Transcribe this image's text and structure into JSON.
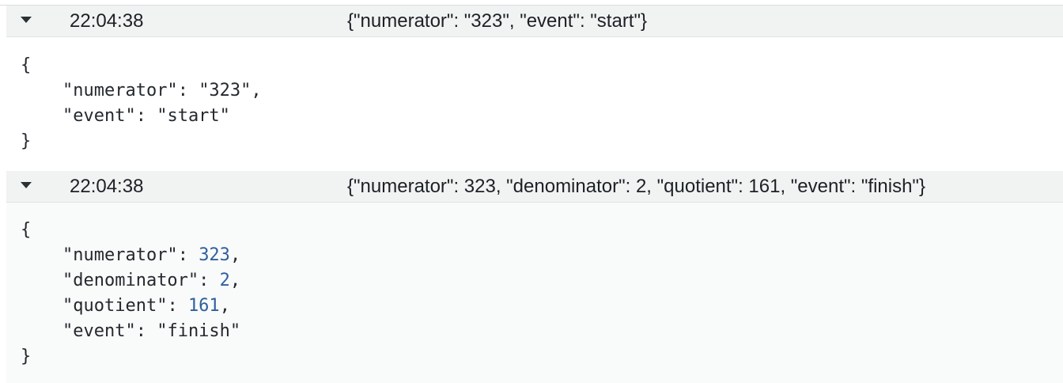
{
  "entries": [
    {
      "timestamp": "22:04:38",
      "message": "{\"numerator\": \"323\", \"event\": \"start\"}",
      "json": {
        "open": "{",
        "close": "}",
        "lines": [
          {
            "key": "\"numerator\"",
            "sep": ": ",
            "value": "\"323\"",
            "comma": ","
          },
          {
            "key": "\"event\"",
            "sep": ": ",
            "value": "\"start\"",
            "comma": ""
          }
        ]
      }
    },
    {
      "timestamp": "22:04:38",
      "message": "{\"numerator\": 323, \"denominator\": 2, \"quotient\": 161, \"event\": \"finish\"}",
      "json": {
        "open": "{",
        "close": "}",
        "lines": [
          {
            "key": "\"numerator\"",
            "sep": ": ",
            "value": "323",
            "comma": ","
          },
          {
            "key": "\"denominator\"",
            "sep": ": ",
            "value": "2",
            "comma": ","
          },
          {
            "key": "\"quotient\"",
            "sep": ": ",
            "value": "161",
            "comma": ","
          },
          {
            "key": "\"event\"",
            "sep": ": ",
            "value": "\"finish\"",
            "comma": ""
          }
        ]
      }
    }
  ],
  "colors": {
    "number_value": "#2f5f9e",
    "row_background": "#f1f3f3",
    "text": "#1d2125"
  },
  "icons": {
    "expand_toggle": "triangle-down-icon"
  }
}
